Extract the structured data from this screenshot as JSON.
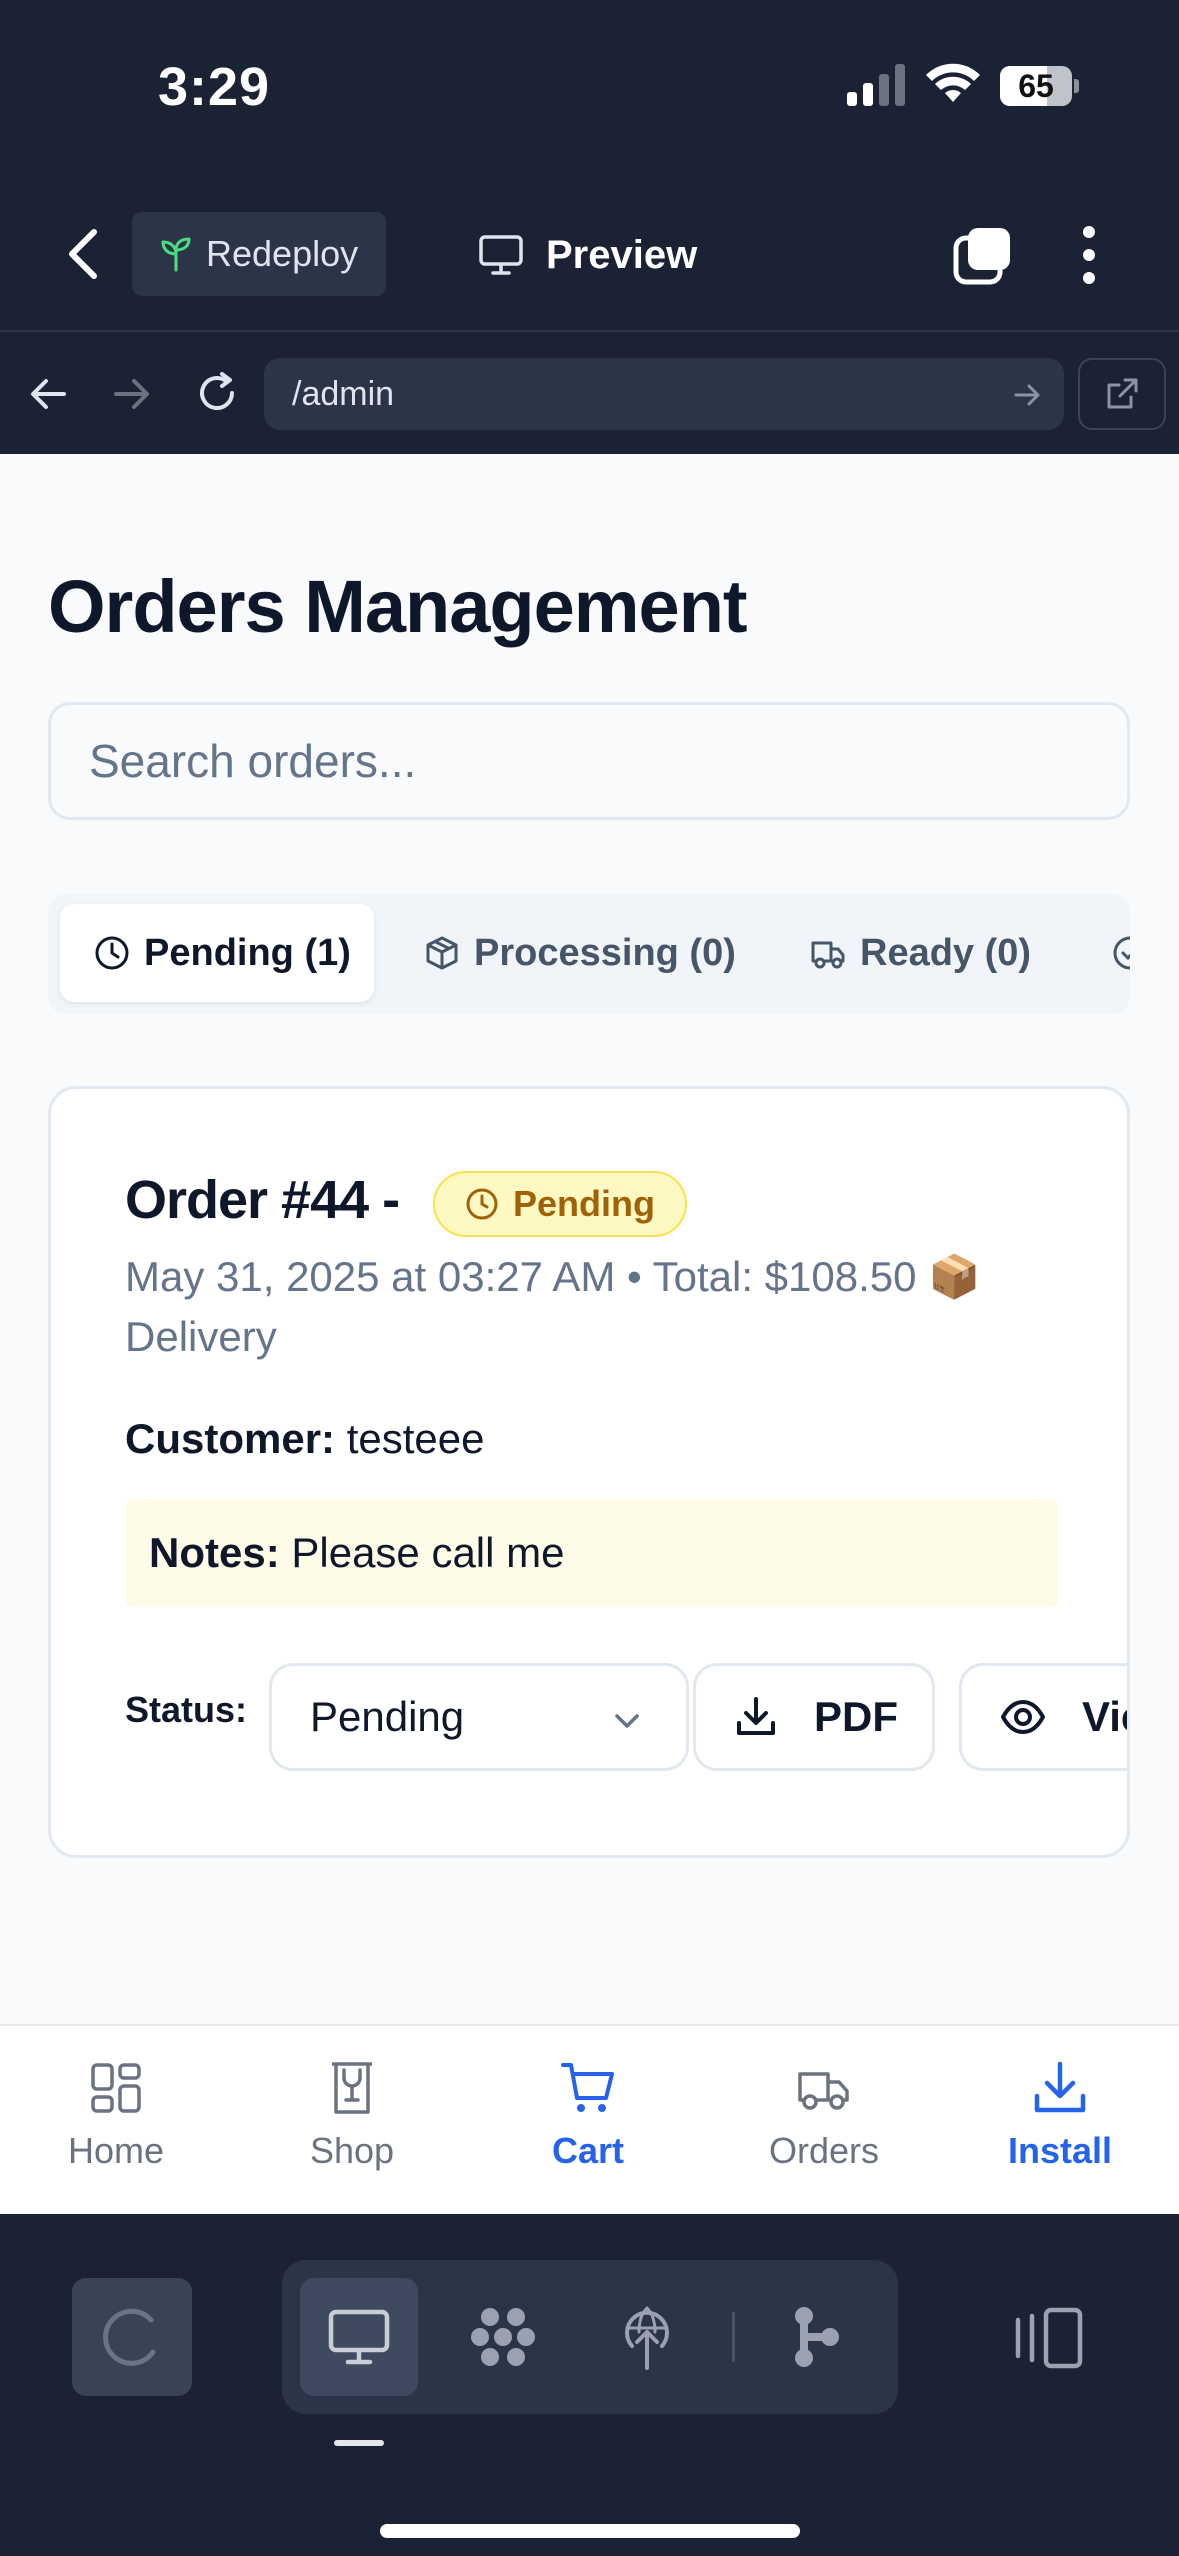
{
  "status_bar": {
    "time": "3:29",
    "battery_level": "65",
    "battery_fraction": 0.65
  },
  "toolbar": {
    "redeploy_label": "Redeploy",
    "preview_label": "Preview"
  },
  "browser": {
    "url": "/admin"
  },
  "page": {
    "title": "Orders Management",
    "search_placeholder": "Search orders..."
  },
  "status_tabs": [
    {
      "label": "Pending (1)",
      "icon": "clock-icon",
      "active": true
    },
    {
      "label": "Processing (0)",
      "icon": "box-icon",
      "active": false
    },
    {
      "label": "Ready (0)",
      "icon": "truck-icon",
      "active": false
    }
  ],
  "order": {
    "title": "Order #44 -",
    "badge": "Pending",
    "meta": "May 31, 2025 at 03:27 AM • Total: $108.50 📦 Delivery",
    "customer_label": "Customer:",
    "customer_name": "testeee",
    "notes_label": "Notes:",
    "notes_text": "Please call me",
    "status_label": "Status:",
    "status_value": "Pending",
    "pdf_label": "PDF",
    "view_label": "View"
  },
  "bottom_nav": [
    {
      "label": "Home",
      "icon": "grid-icon"
    },
    {
      "label": "Shop",
      "icon": "shop-icon"
    },
    {
      "label": "Cart",
      "icon": "cart-icon"
    },
    {
      "label": "Orders",
      "icon": "truck-icon"
    },
    {
      "label": "Install",
      "icon": "download-icon"
    }
  ],
  "colors": {
    "dark_chrome": "#1b2233",
    "accent_blue": "#2563eb",
    "pending_badge_bg": "#fef9c3",
    "pending_badge_text": "#a16207",
    "notes_bg": "#fefce8"
  }
}
